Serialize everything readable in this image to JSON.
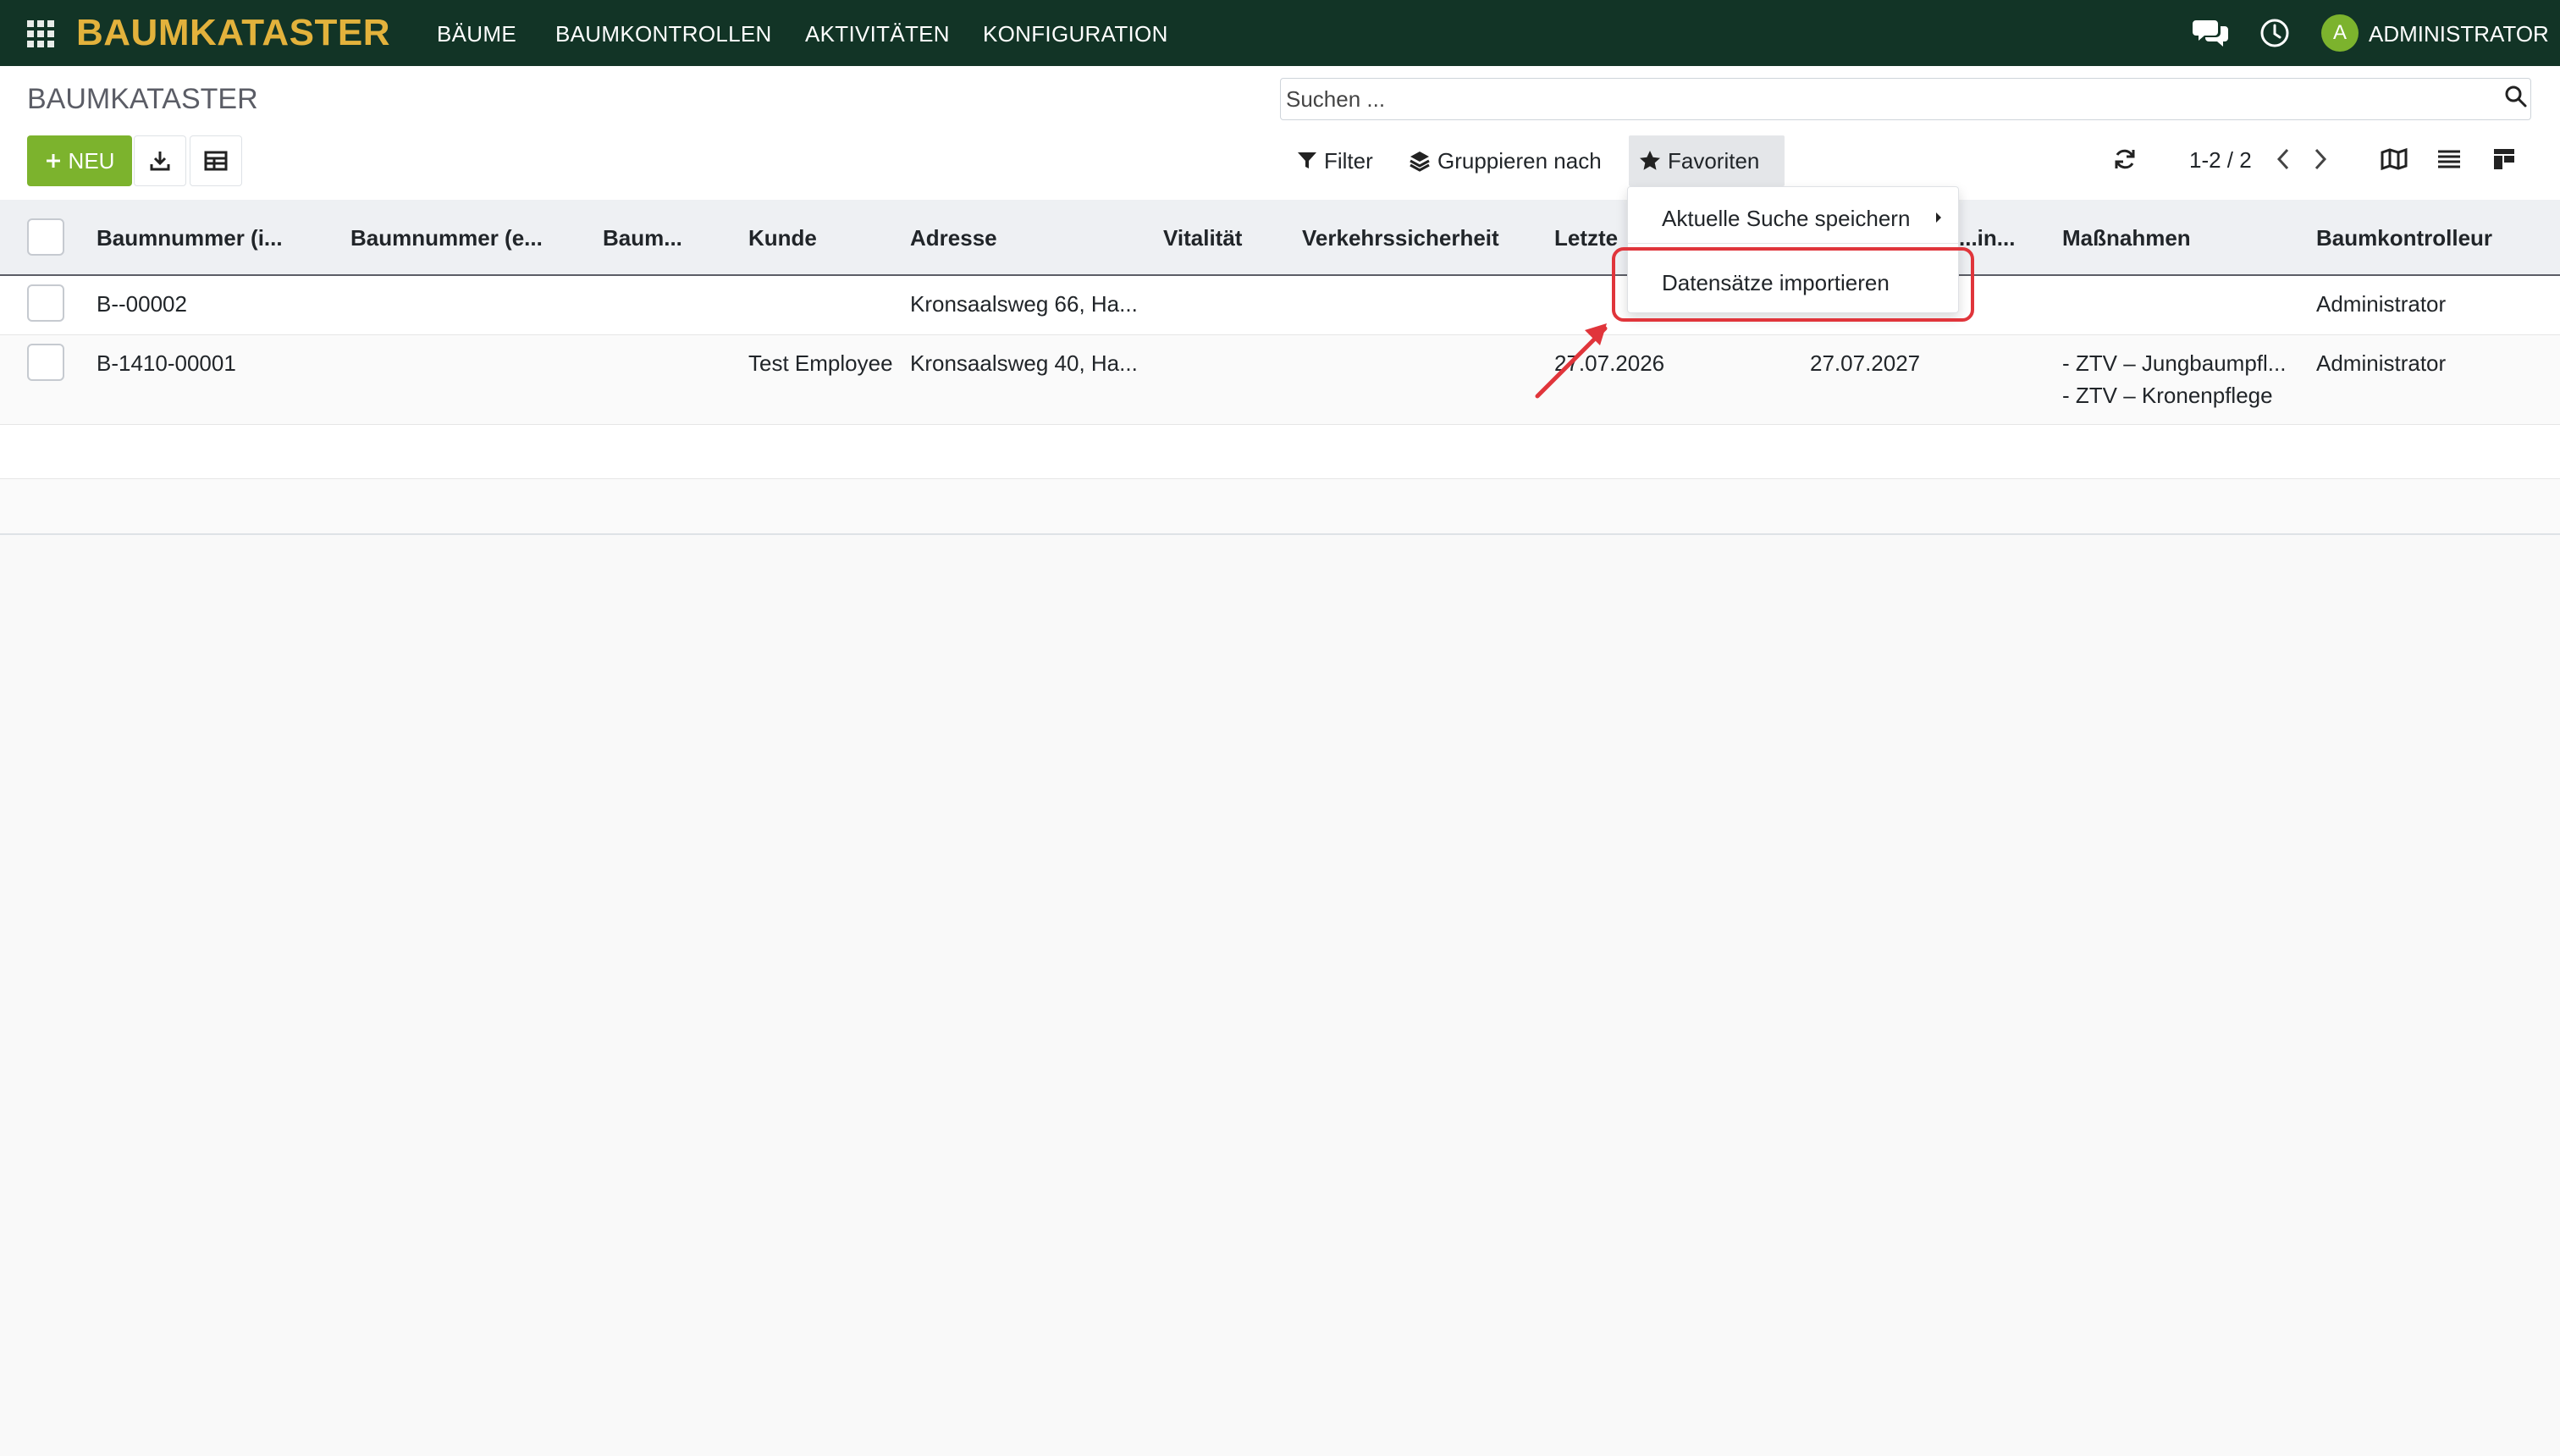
{
  "navbar": {
    "brand": "BAUMKATASTER",
    "menu": [
      "BÄUME",
      "BAUMKONTROLLEN",
      "AKTIVITÄTEN",
      "KONFIGURATION"
    ],
    "user_initial": "A",
    "user_name": "ADMINISTRATOR",
    "icons": [
      "apps-icon",
      "chat-icon",
      "clock-icon"
    ],
    "colors": {
      "background": "#123426",
      "brand": "#e3b23c",
      "avatar": "#7cb32d"
    }
  },
  "control_panel": {
    "breadcrumb": "BAUMKATASTER",
    "new_label": "NEU",
    "search_placeholder": "Suchen ...",
    "filter_label": "Filter",
    "group_label": "Gruppieren nach",
    "favorites_label": "Favoriten",
    "pager": "1-2 / 2",
    "icons": [
      "plus-icon",
      "download-icon",
      "table-icon",
      "search-icon",
      "filter-icon",
      "layers-icon",
      "star-icon",
      "refresh-icon",
      "chevron-left-icon",
      "chevron-right-icon",
      "map-icon",
      "list-icon",
      "kanban-icon"
    ],
    "colors": {
      "primary": "#7cb32d"
    }
  },
  "favorites_menu": {
    "items": [
      "Aktuelle Suche speichern",
      "Datensätze importieren"
    ],
    "highlight_color": "#e0353b"
  },
  "table": {
    "columns": [
      "Baumnummer (i...",
      "Baumnummer (e...",
      "Baum...",
      "Kunde",
      "Adresse",
      "Vitalität",
      "Verkehrssicherheit",
      "Letzte",
      "...in...",
      "Maßnahmen",
      "Baumkontrolleur"
    ],
    "rows": [
      {
        "baumnummer_i": "B--00002",
        "kunde": "",
        "adresse": "Kronsaalsweg 66, Ha...",
        "letzte": "",
        "naechste": "",
        "massnahmen": [],
        "kontrolleur": "Administrator"
      },
      {
        "baumnummer_i": "B-1410-00001",
        "kunde": "Test Employee",
        "adresse": "Kronsaalsweg 40, Ha...",
        "letzte": "27.07.2026",
        "naechste": "27.07.2027",
        "massnahmen": [
          "- ZTV – Jungbaumpfl...",
          "- ZTV – Kronenpflege"
        ],
        "kontrolleur": "Administrator"
      }
    ]
  }
}
